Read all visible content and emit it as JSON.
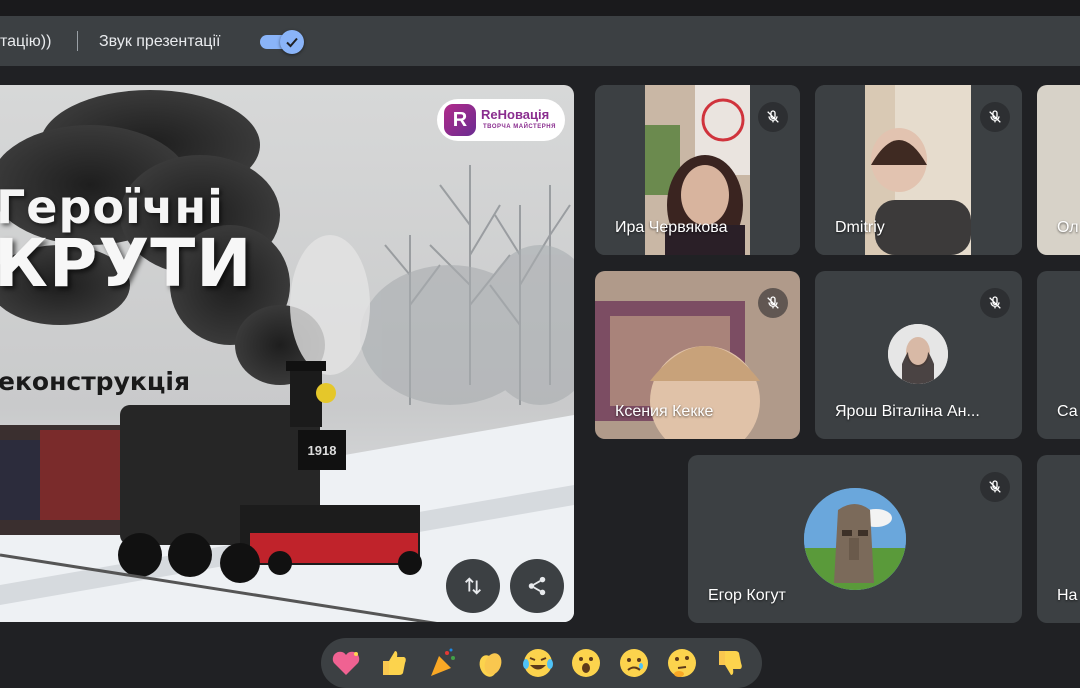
{
  "top_bar": {
    "cut_text": "тацію))",
    "sound_label": "Звук презентації",
    "sound_toggle_on": true
  },
  "presentation": {
    "title_line1": "Героїчні",
    "title_line2": "КРУТИ",
    "subtitle": "еконструкція",
    "logo_name": "ReНовація",
    "logo_tagline": "ТВОРЧА МАЙСТЕРНЯ",
    "train_number": "1918"
  },
  "participants": [
    {
      "name": "Ира Червякова",
      "muted": true
    },
    {
      "name": "Dmitriy",
      "muted": true
    },
    {
      "name": "Ол",
      "muted": true
    },
    {
      "name": "Ксения Кекке",
      "muted": true
    },
    {
      "name": "Ярош Віталіна Ан...",
      "muted": true
    },
    {
      "name": "Са",
      "muted": true
    },
    {
      "name": "Егор Когут",
      "muted": true
    },
    {
      "name": "На",
      "muted": true
    }
  ],
  "reactions": [
    "sparkling-heart",
    "thumbs-up",
    "party-popper",
    "clapping-hands",
    "tears-of-joy",
    "surprised-face",
    "sad-face",
    "thinking-face",
    "thumbs-down"
  ],
  "colors": {
    "accent": "#8ab4f8",
    "bar": "#3c4043",
    "background": "#202124"
  }
}
